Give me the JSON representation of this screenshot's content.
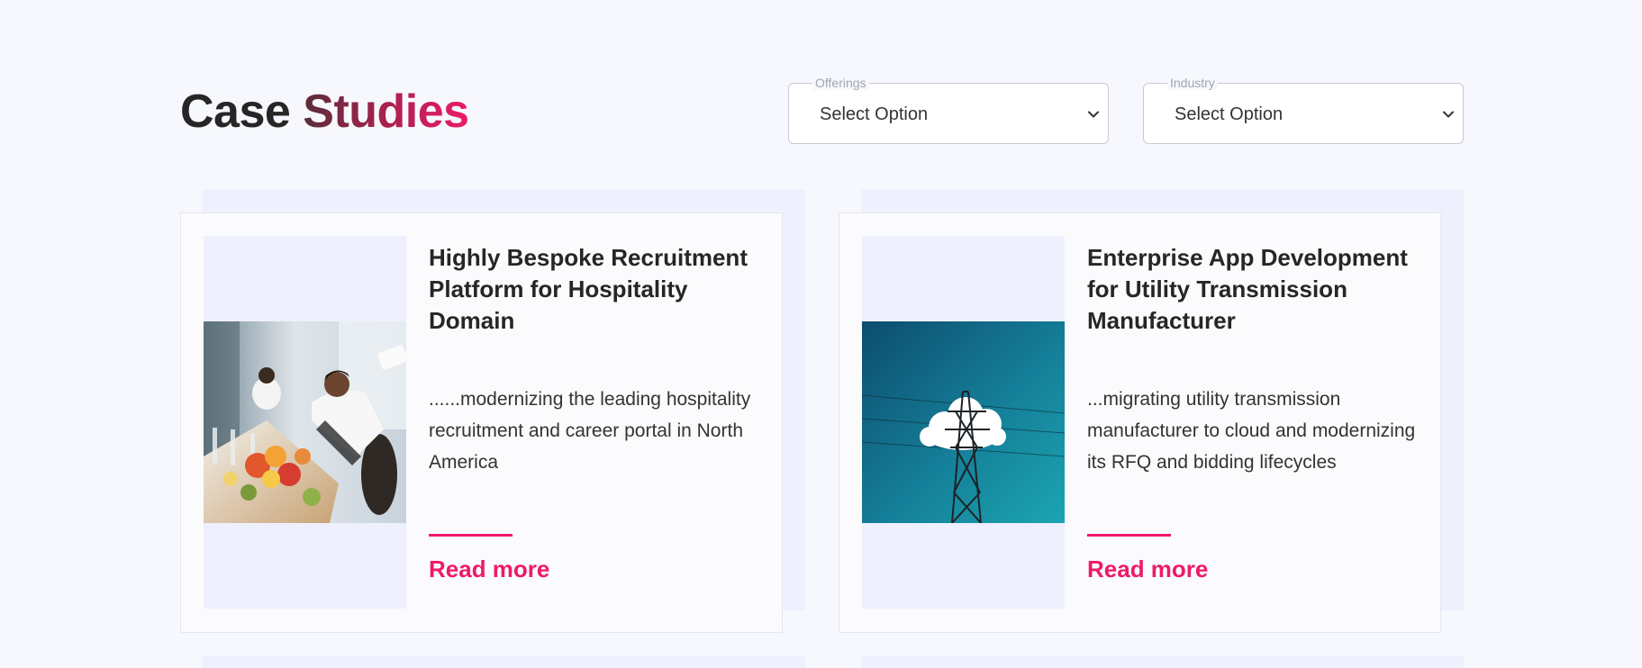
{
  "header": {
    "title_part1": "Case ",
    "title_part2": "Studies"
  },
  "filters": [
    {
      "legend": "Offerings",
      "value": "Select Option",
      "icon": "chevron-down-icon"
    },
    {
      "legend": "Industry",
      "value": "Select Option",
      "icon": "chevron-down-icon"
    }
  ],
  "cards": [
    {
      "title": "Highly Bespoke Recruitment Platform for Hospitality Domain",
      "description": "......modernizing the leading hospitality recruitment and career portal in North America",
      "link": "Read more",
      "image": "restaurant-waiter-photo"
    },
    {
      "title": "Enterprise App Development for Utility Transmission Manufacturer",
      "description": "...migrating utility transmission manufacturer to cloud and modernizing its RFQ and bidding lifecycles",
      "link": "Read more",
      "image": "power-pylon-cloud-photo"
    }
  ],
  "colors": {
    "accent": "#ee1a69",
    "background": "#f7f8fd",
    "card_shadow": "#eff0fd",
    "text": "#262626"
  }
}
